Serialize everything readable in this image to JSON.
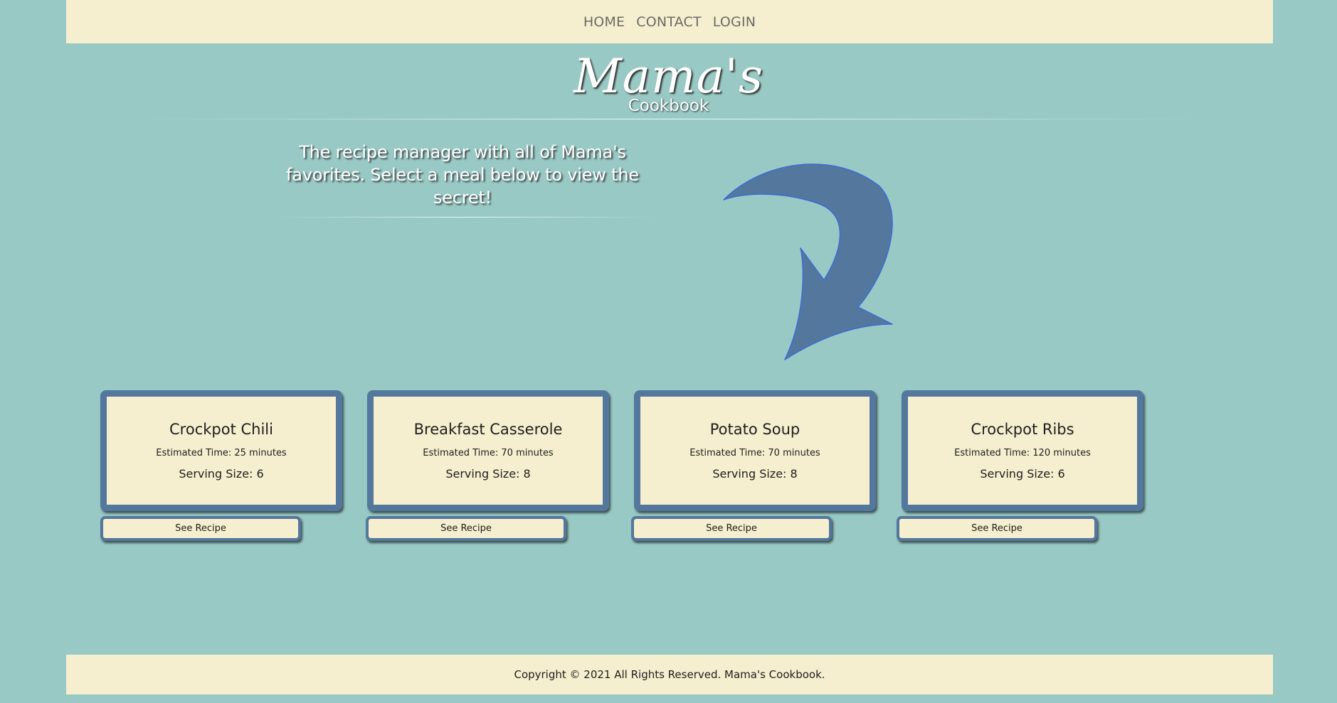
{
  "nav": {
    "links": [
      "HOME",
      "CONTACT",
      "LOGIN"
    ]
  },
  "logo": {
    "main": "Mama's",
    "sub": "Cookbook"
  },
  "tagline": "The recipe manager with all of Mama's favorites. Select a meal below to view the secret!",
  "decoration": {
    "arrow_icon": "curved-arrow-down-icon",
    "arrow_color": "#54779e"
  },
  "recipes": [
    {
      "name": "Crockpot Chili",
      "time": "Estimated Time: 25 minutes",
      "serving": "Serving Size: 6",
      "button": "See Recipe"
    },
    {
      "name": "Breakfast Casserole",
      "time": "Estimated Time: 70 minutes",
      "serving": "Serving Size: 8",
      "button": "See Recipe"
    },
    {
      "name": "Potato Soup",
      "time": "Estimated Time: 70 minutes",
      "serving": "Serving Size: 8",
      "button": "See Recipe"
    },
    {
      "name": "Crockpot Ribs",
      "time": "Estimated Time: 120 minutes",
      "serving": "Serving Size: 6",
      "button": "See Recipe"
    }
  ],
  "footer": {
    "text": "Copyright © 2021 All Rights Reserved. Mama's Cookbook."
  },
  "colors": {
    "background": "#98c9c5",
    "cream": "#f5efcf",
    "accent_blue": "#54779e"
  }
}
